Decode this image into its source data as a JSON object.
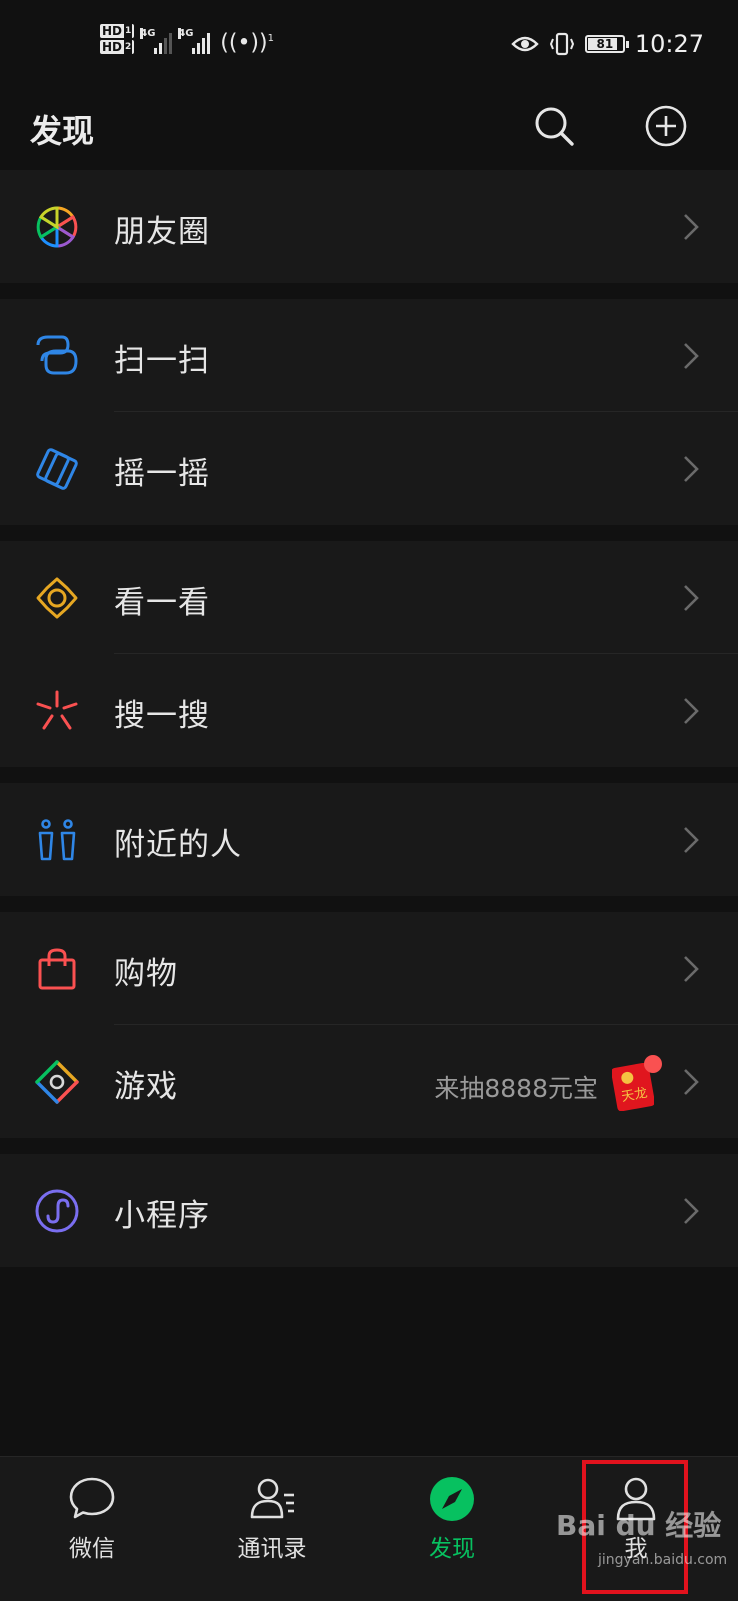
{
  "status_bar": {
    "hd1": "HD",
    "hd1_sub": "1",
    "hd2": "HD",
    "hd2_sub": "2",
    "net1": "4G",
    "net2": "4G",
    "hotspot_count": "1",
    "battery": "81",
    "time": "10:27"
  },
  "header": {
    "title": "发现",
    "search_icon": "search-icon",
    "add_icon": "plus-circle-icon"
  },
  "menu": {
    "moments": {
      "label": "朋友圈",
      "icon": "moments-aperture-icon"
    },
    "scan": {
      "label": "扫一扫",
      "icon": "scan-icon"
    },
    "shake": {
      "label": "摇一摇",
      "icon": "shake-icon"
    },
    "top_stories": {
      "label": "看一看",
      "icon": "top-stories-icon"
    },
    "search": {
      "label": "搜一搜",
      "icon": "search-spark-icon"
    },
    "nearby": {
      "label": "附近的人",
      "icon": "people-nearby-icon"
    },
    "shopping": {
      "label": "购物",
      "icon": "shopping-bag-icon"
    },
    "games": {
      "label": "游戏",
      "icon": "games-icon",
      "promo": "来抽8888元宝",
      "promo_badge": "天龙"
    },
    "mini_programs": {
      "label": "小程序",
      "icon": "mini-program-icon"
    }
  },
  "tabbar": {
    "chats": "微信",
    "contacts": "通讯录",
    "discover": "发现",
    "me": "我"
  },
  "watermark": {
    "brand": "Bai du 经验",
    "url": "jingyan.baidu.com"
  },
  "colors": {
    "accent": "#07c160",
    "background": "#111111",
    "row_background": "#191919",
    "highlight": "#e1121d"
  }
}
